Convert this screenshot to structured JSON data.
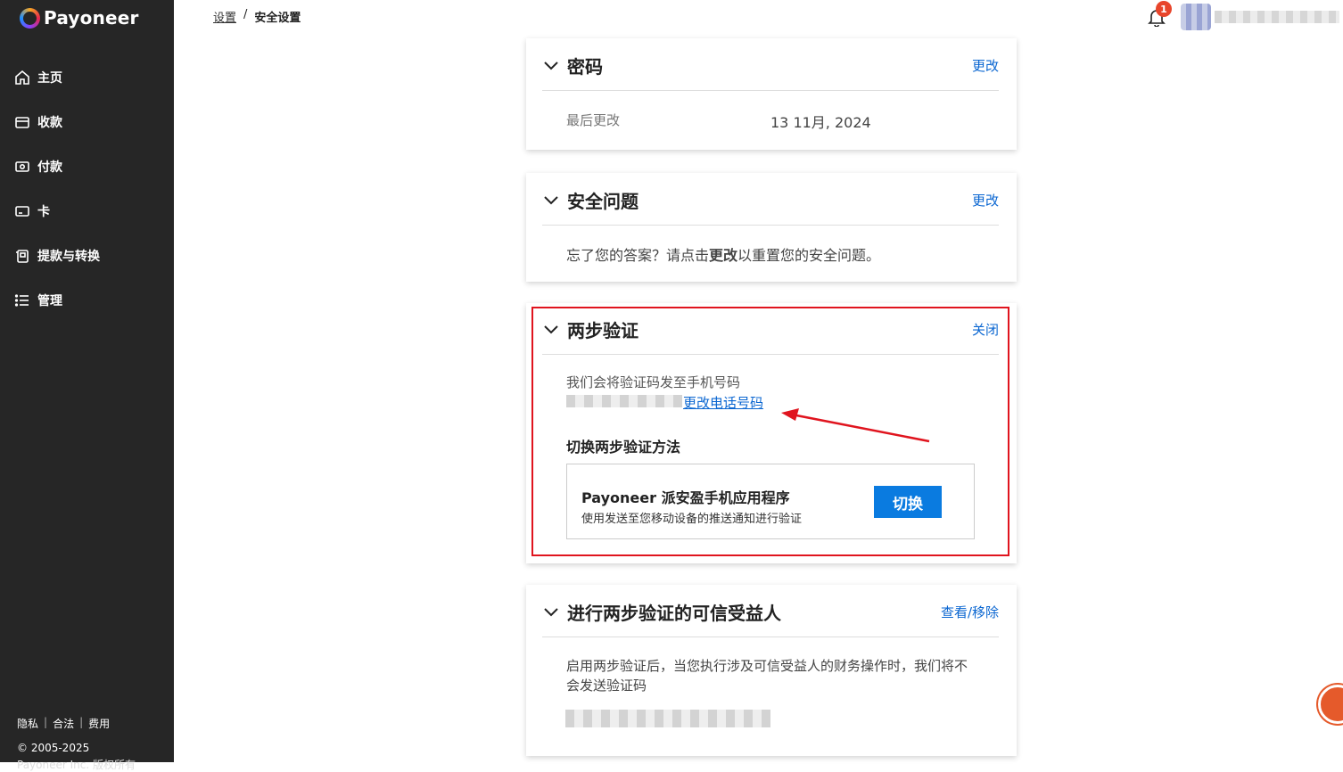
{
  "brand": {
    "name": "Payoneer"
  },
  "sidebar": {
    "items": [
      {
        "label": "主页",
        "icon": "home-icon"
      },
      {
        "label": "收款",
        "icon": "receive-icon"
      },
      {
        "label": "付款",
        "icon": "pay-icon"
      },
      {
        "label": "卡",
        "icon": "card-icon"
      },
      {
        "label": "提款与转换",
        "icon": "withdraw-icon"
      },
      {
        "label": "管理",
        "icon": "list-icon"
      }
    ],
    "footer": {
      "privacy": "隐私",
      "legal": "合法",
      "fees": "费用",
      "copyright": "© 2005-2025",
      "rights": "Payoneer Inc. 版权所有"
    }
  },
  "breadcrumb": {
    "parent": "设置",
    "separator": "/",
    "current": "安全设置"
  },
  "notifications": {
    "count": "1"
  },
  "password": {
    "title": "密码",
    "action": "更改",
    "last_changed_label": "最后更改",
    "last_changed_value": "13 11月, 2024"
  },
  "security_questions": {
    "title": "安全问题",
    "action": "更改",
    "text_before": "忘了您的答案？请点击",
    "text_bold": "更改",
    "text_after": "以重置您的安全问题。"
  },
  "two_step": {
    "title": "两步验证",
    "action": "关闭",
    "sent_to": "我们会将验证码发至手机号码",
    "change_phone": "更改电话号码",
    "switch_heading": "切换两步验证方法",
    "method_title": "Payoneer 派安盈手机应用程序",
    "method_desc": "使用发送至您移动设备的推送通知进行验证",
    "switch_label": "切换"
  },
  "trusted": {
    "title": "进行两步验证的可信受益人",
    "action": "查看/移除",
    "desc": "启用两步验证后，当您执行涉及可信受益人的财务操作时，我们将不会发送验证码"
  },
  "colors": {
    "accent": "#0a66d1",
    "sidebar": "#262626",
    "highlight": "#e0141e"
  }
}
